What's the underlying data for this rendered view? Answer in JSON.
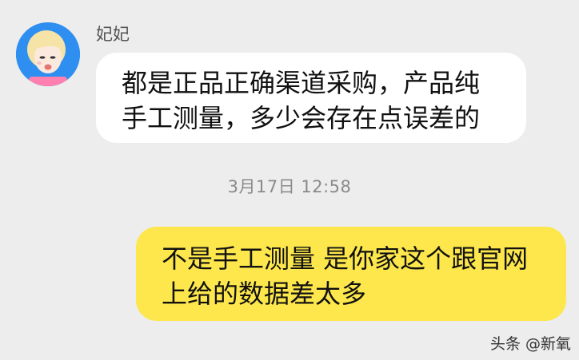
{
  "chat": {
    "incoming": {
      "sender_name": "妃妃",
      "lines": [
        "都是正品正确渠道采购，产品纯",
        "手工测量，多少会存在点误差的"
      ]
    },
    "timestamp": "3月17日 12:58",
    "outgoing": {
      "lines": [
        "不是手工测量 是你家这个跟官网",
        "上给的数据差太多"
      ]
    }
  },
  "watermark": "头条 @新氧",
  "colors": {
    "background": "#ededed",
    "incoming_bubble": "#ffffff",
    "outgoing_bubble": "#fde74c",
    "avatar_background": "#2f8ff0"
  },
  "icons": {
    "avatar": "cartoon-girl-avatar"
  }
}
